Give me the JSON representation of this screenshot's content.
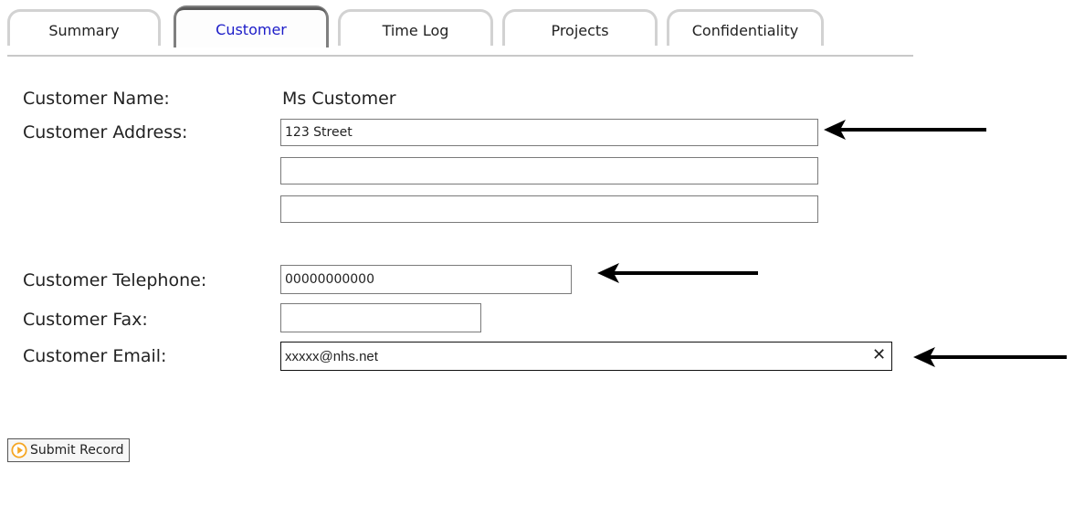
{
  "tabs": [
    {
      "label": "Summary"
    },
    {
      "label": "Customer"
    },
    {
      "label": "Time Log"
    },
    {
      "label": "Projects"
    },
    {
      "label": "Confidentiality"
    }
  ],
  "active_tab": "Customer",
  "form": {
    "name_label": "Customer Name:",
    "name_value": "Ms Customer",
    "address_label": "Customer Address:",
    "address_line1": "123 Street",
    "address_line2": "",
    "address_line3": "",
    "telephone_label": "Customer Telephone:",
    "telephone_value": "00000000000",
    "fax_label": "Customer Fax:",
    "fax_value": "",
    "email_label": "Customer Email:",
    "email_value": "xxxxx@nhs.net",
    "email_clear_glyph": "✕"
  },
  "submit_label": "Submit Record",
  "colors": {
    "active_tab_text": "#1c1cc8",
    "submit_icon": "#f5a623"
  },
  "icons": [
    "play-circle-icon",
    "clear-icon",
    "arrow-left-icon"
  ]
}
